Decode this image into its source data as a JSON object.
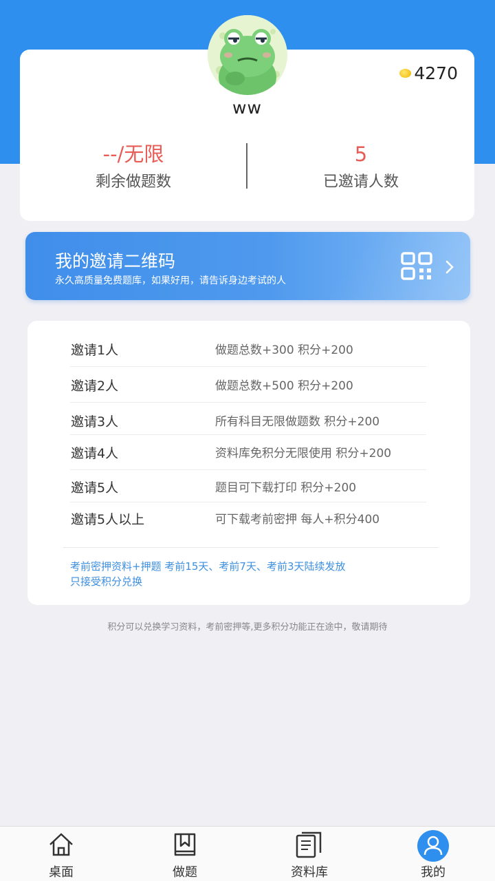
{
  "profile": {
    "username": "ww",
    "coins": "4270",
    "stats": [
      {
        "value": "--/无限",
        "label": "剩余做题数"
      },
      {
        "value": "5",
        "label": "已邀请人数"
      }
    ]
  },
  "qr_banner": {
    "title": "我的邀请二维码",
    "subtitle": "永久高质量免费题库，如果好用，请告诉身边考试的人"
  },
  "rewards": {
    "rows": [
      {
        "left": "邀请1人",
        "right": "做题总数+300   积分+200"
      },
      {
        "left": "邀请2人",
        "right": "做题总数+500   积分+200"
      },
      {
        "left": "邀请3人",
        "right": "所有科目无限做题数   积分+200"
      },
      {
        "left": "邀请4人",
        "right": "资料库免积分无限使用   积分+200"
      },
      {
        "left": "邀请5人",
        "right": "题目可下载打印   积分+200"
      },
      {
        "left": "邀请5人以上",
        "right": "可下载考前密押   每人+积分400"
      }
    ],
    "note_line1": "考前密押资料+押题 考前15天、考前7天、考前3天陆续发放",
    "note_line2": "只接受积分兑换"
  },
  "footer_note": "积分可以兑换学习资料，考前密押等,更多积分功能正在途中，敬请期待",
  "tabbar": {
    "tabs": [
      {
        "label": "桌面",
        "icon": "home-icon"
      },
      {
        "label": "做题",
        "icon": "book-bookmark-icon"
      },
      {
        "label": "资料库",
        "icon": "documents-icon"
      },
      {
        "label": "我的",
        "icon": "user-icon",
        "active": true
      }
    ]
  },
  "colors": {
    "primary": "#2f8fee",
    "stat_value": "#e85c56",
    "note_text": "#3d8fe0"
  }
}
